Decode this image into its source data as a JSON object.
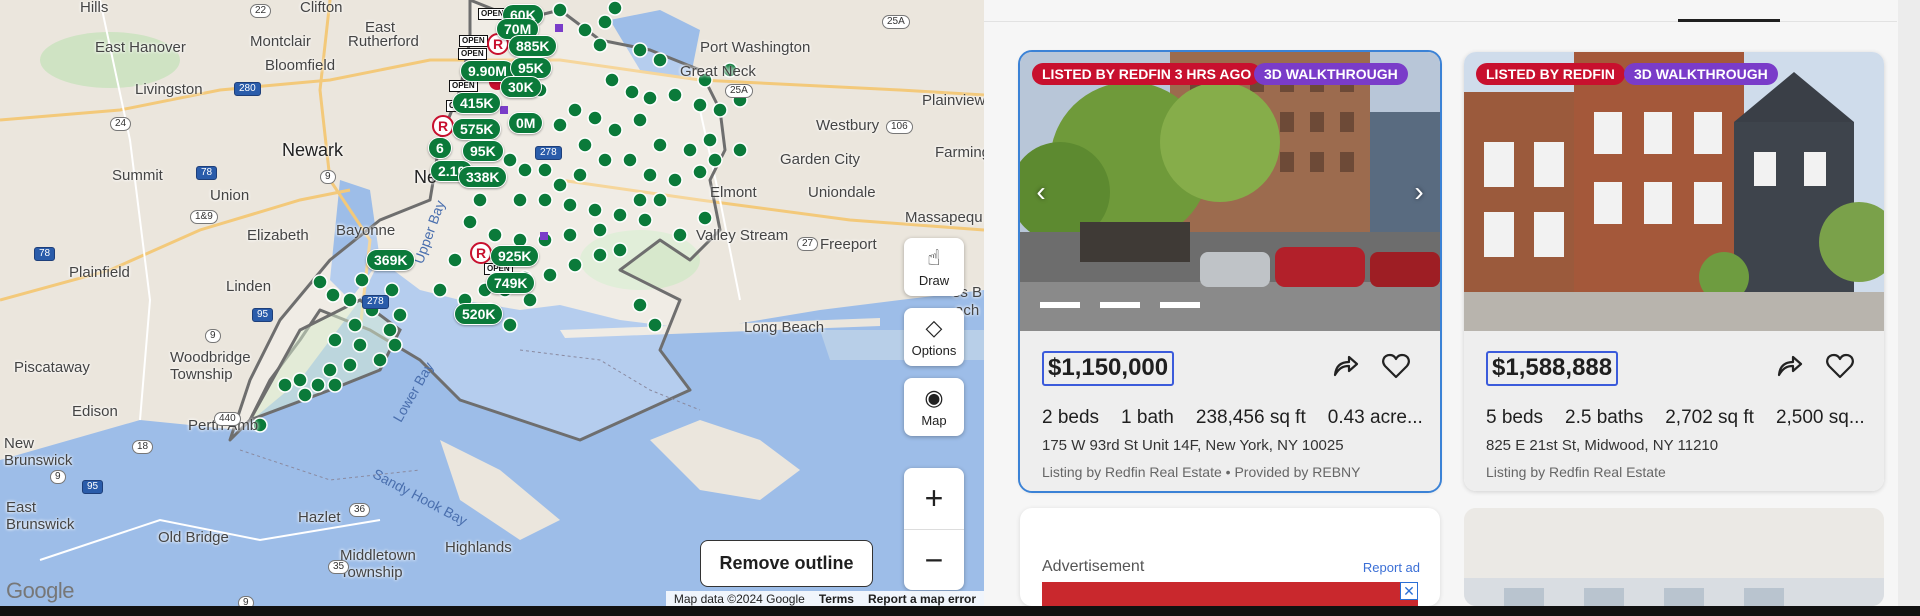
{
  "map": {
    "labels": {
      "cities": [
        "Hills",
        "Clifton",
        "East Hanover",
        "Montclair",
        "Rutherford",
        "Port Washington",
        "Bloomfield",
        "Great Neck",
        "Livingston",
        "Plainview",
        "Westbury",
        "Newark",
        "Garden City",
        "Farming",
        "Summit",
        "Union",
        "Uniondale",
        "Elmont",
        "Massapequ",
        "Elizabeth",
        "Bayonne",
        "Valley Stream",
        "Freeport",
        "Plainfield",
        "Linden",
        "Long Beach",
        "Piscataway",
        "Woodbridge Township",
        "Edison",
        "Perth Amb",
        "New Brunswick",
        "East Brunswick",
        "Old Bridge",
        "Hazlet",
        "Middletown Township",
        "Highlands",
        "East",
        "Ne",
        "es B",
        "ach"
      ],
      "water": [
        "Upper Bay",
        "Lower Bay",
        "Sandy Hook Bay"
      ],
      "shields": [
        "280",
        "24",
        "78",
        "9",
        "78",
        "1&9",
        "278",
        "95",
        "9",
        "440",
        "278",
        "25A",
        "25A",
        "106",
        "27",
        "36",
        "35",
        "9",
        "18",
        "95",
        "9",
        "22"
      ]
    },
    "price_pins": [
      "60K",
      "70M",
      "885K",
      "9.90M",
      "95K",
      "30K",
      "415K",
      "0M",
      "575K",
      "6",
      "95K",
      "2.10",
      "338K",
      "925K",
      "369K",
      "749K",
      "520K"
    ],
    "open_tag": "OPEN",
    "r_pin": "R",
    "controls": {
      "draw": "Draw",
      "options": "Options",
      "map_type": "Map",
      "zoom_in": "+",
      "zoom_out": "−",
      "remove_outline": "Remove outline"
    },
    "google": "Google",
    "attribution": {
      "data": "Map data ©2024 Google",
      "terms": "Terms",
      "report": "Report a map error"
    }
  },
  "listings": [
    {
      "badge1": "LISTED BY REDFIN 3 HRS AGO",
      "badge2": "3D WALKTHROUGH",
      "price": "$1,150,000",
      "beds": "2 beds",
      "baths": "1 bath",
      "sqft": "238,456 sq ft",
      "lot": "0.43 acre...",
      "address": "175 W 93rd St Unit 14F, New York, NY 10025",
      "byline": "Listing by Redfin Real Estate • Provided by REBNY"
    },
    {
      "badge1": "LISTED BY REDFIN",
      "badge2": "3D WALKTHROUGH",
      "price": "$1,588,888",
      "beds": "5 beds",
      "baths": "2.5 baths",
      "sqft": "2,702 sq ft",
      "lot": "2,500 sq...",
      "address": "825 E 21st St, Midwood, NY 11210",
      "byline": "Listing by Redfin Real Estate"
    }
  ],
  "ad": {
    "label": "Advertisement",
    "report": "Report ad",
    "close": "✕"
  },
  "colors": {
    "pin_green": "#0b7a3a",
    "redfin_red": "#c8102e",
    "walkthrough_purple": "#7a3cc9",
    "water": "#9dbde8",
    "selected_outline": "#3b82d6"
  }
}
